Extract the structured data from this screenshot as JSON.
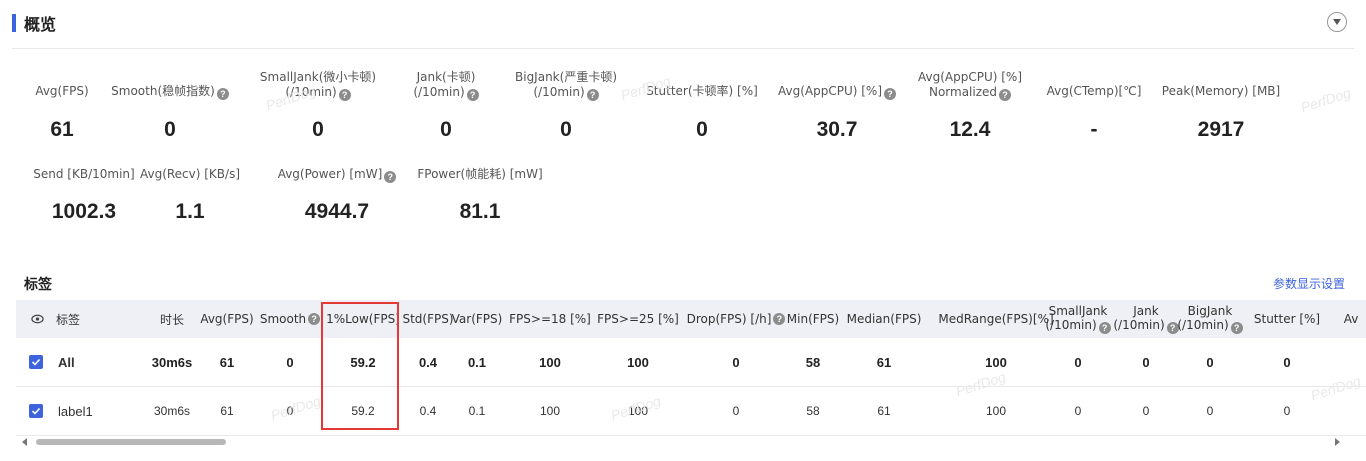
{
  "overview": {
    "title": "概览",
    "metrics_row1": [
      {
        "label_lines": [
          "Avg(FPS)"
        ],
        "help": false,
        "value": "61"
      },
      {
        "label_lines": [
          "Smooth(稳帧指数)"
        ],
        "help": true,
        "value": "0"
      },
      {
        "label_lines": [
          "SmallJank(微小卡顿)",
          "(/10min)"
        ],
        "help": true,
        "value": "0"
      },
      {
        "label_lines": [
          "Jank(卡顿)",
          "(/10min)"
        ],
        "help": true,
        "value": "0"
      },
      {
        "label_lines": [
          "BigJank(严重卡顿)",
          "(/10min)"
        ],
        "help": true,
        "value": "0"
      },
      {
        "label_lines": [
          "Stutter(卡顿率) [%]"
        ],
        "help": false,
        "value": "0"
      },
      {
        "label_lines": [
          "Avg(AppCPU) [%]"
        ],
        "help": true,
        "value": "30.7"
      },
      {
        "label_lines": [
          "Avg(AppCPU) [%]",
          "Normalized"
        ],
        "help": true,
        "value": "12.4"
      },
      {
        "label_lines": [
          "Avg(CTemp)[℃]"
        ],
        "help": false,
        "value": "-"
      },
      {
        "label_lines": [
          "Peak(Memory) [MB]"
        ],
        "help": false,
        "value": "2917"
      }
    ],
    "metrics_row2": [
      {
        "label_lines": [
          "Send [KB/10min]"
        ],
        "help": false,
        "value": "1002.3"
      },
      {
        "label_lines": [
          "Avg(Recv) [KB/s]"
        ],
        "help": false,
        "value": "1.1"
      },
      {
        "label_lines": [
          "Avg(Power) [mW]"
        ],
        "help": true,
        "value": "4944.7"
      },
      {
        "label_lines": [
          "FPower(帧能耗) [mW]"
        ],
        "help": false,
        "value": "81.1"
      }
    ]
  },
  "labels_section": {
    "title": "标签",
    "config_link": "参数显示设置",
    "columns": [
      {
        "label": "标签",
        "help": false
      },
      {
        "label": "时长",
        "help": false
      },
      {
        "label": "Avg(FPS)",
        "help": false
      },
      {
        "label": "Smooth",
        "help": true
      },
      {
        "label": "1%Low(FPS)",
        "help": false
      },
      {
        "label": "Std(FPS)",
        "help": false
      },
      {
        "label": "Var(FPS)",
        "help": false
      },
      {
        "label": "FPS>=18 [%]",
        "help": false
      },
      {
        "label": "FPS>=25 [%]",
        "help": false
      },
      {
        "label": "Drop(FPS) [/h]",
        "help": true
      },
      {
        "label": "Min(FPS)",
        "help": false
      },
      {
        "label": "Median(FPS)",
        "help": false
      },
      {
        "label": "MedRange(FPS)[%]",
        "help": false
      },
      {
        "label": "SmallJank|(/10min)",
        "help": true
      },
      {
        "label": "Jank|(/10min)",
        "help": true
      },
      {
        "label": "BigJank|(/10min)",
        "help": true
      },
      {
        "label": "Stutter [%]",
        "help": false
      },
      {
        "label": "Av",
        "help": false
      }
    ],
    "rows": [
      {
        "name": "All",
        "checked": true,
        "cells": [
          "30m6s",
          "61",
          "0",
          "59.2",
          "0.4",
          "0.1",
          "100",
          "100",
          "0",
          "58",
          "61",
          "100",
          "0",
          "0",
          "0",
          "0"
        ]
      },
      {
        "name": "label1",
        "checked": true,
        "cells": [
          "30m6s",
          "61",
          "0",
          "59.2",
          "0.4",
          "0.1",
          "100",
          "100",
          "0",
          "58",
          "61",
          "100",
          "0",
          "0",
          "0",
          "0"
        ]
      }
    ]
  },
  "watermark": "PerfDog"
}
